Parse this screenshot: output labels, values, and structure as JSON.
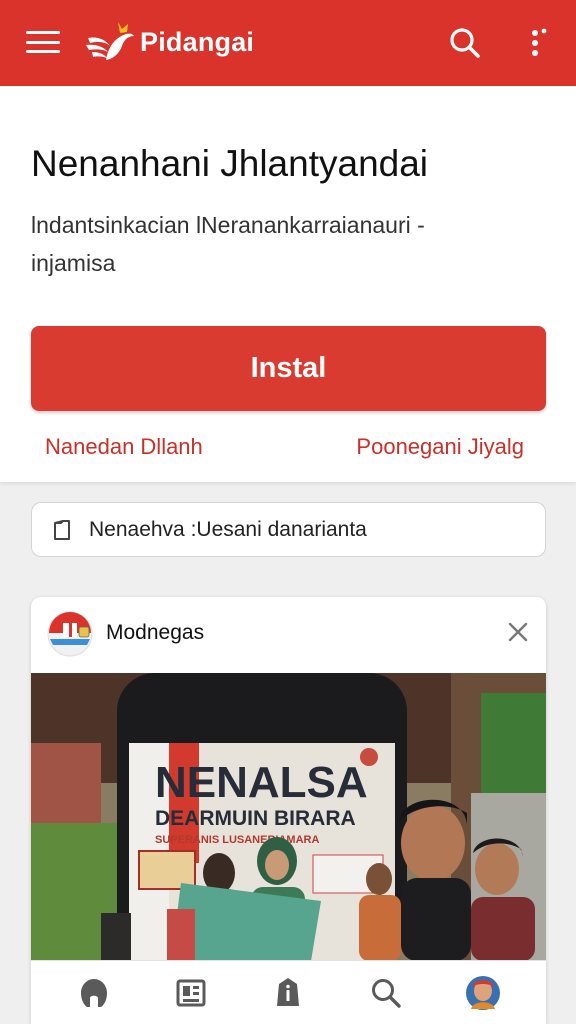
{
  "app": {
    "name": "Pidangai"
  },
  "hero": {
    "title": "Nenanhani Jhlantyandai",
    "description": "lndantsinkacian lNeranankarraianauri - injamisa",
    "install_label": "Instal",
    "link_left": "Nanedan Dllanh",
    "link_right": "Poonegani Jiyalg"
  },
  "search": {
    "text": "Nenaehva :Uesani danarianta"
  },
  "card": {
    "title": "Modnegas",
    "image_text": {
      "line1": "NENALSA",
      "line2": "DEARMUIN BIRARA",
      "line3": "SUPERANIS LUSANERIAMARA"
    }
  },
  "bottom_nav": {
    "items": [
      {
        "icon": "home-icon"
      },
      {
        "icon": "news-icon"
      },
      {
        "icon": "info-icon"
      },
      {
        "icon": "search-icon"
      },
      {
        "icon": "profile-avatar"
      }
    ]
  },
  "colors": {
    "brand_red": "#d9332b",
    "button_red": "#da3b31",
    "link_red": "#cc2f27",
    "background": "#efefef"
  }
}
